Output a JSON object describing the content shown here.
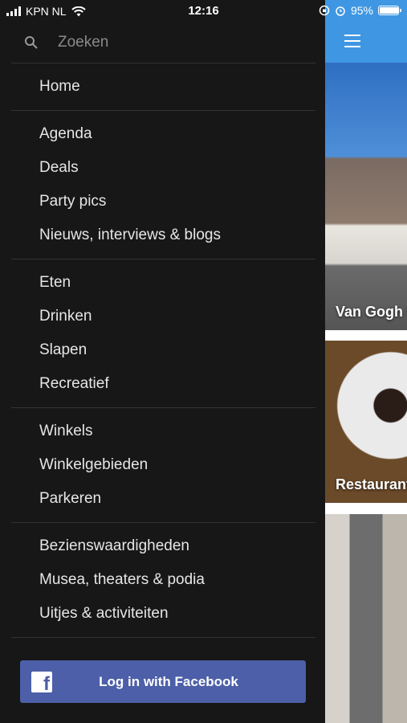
{
  "status": {
    "carrier": "KPN NL",
    "time": "12:16",
    "battery": "95%",
    "battery_level": 0.95
  },
  "search": {
    "placeholder": "Zoeken"
  },
  "menu": {
    "groups": [
      {
        "items": [
          {
            "label": "Home"
          }
        ]
      },
      {
        "items": [
          {
            "label": "Agenda"
          },
          {
            "label": "Deals"
          },
          {
            "label": "Party pics"
          },
          {
            "label": "Nieuws, interviews & blogs"
          }
        ]
      },
      {
        "items": [
          {
            "label": "Eten"
          },
          {
            "label": "Drinken"
          },
          {
            "label": "Slapen"
          },
          {
            "label": "Recreatief"
          }
        ]
      },
      {
        "items": [
          {
            "label": "Winkels"
          },
          {
            "label": "Winkelgebieden"
          },
          {
            "label": "Parkeren"
          }
        ]
      },
      {
        "items": [
          {
            "label": "Bezienswaardigheden"
          },
          {
            "label": "Musea, theaters & podia"
          },
          {
            "label": "Uitjes & activiteiten"
          }
        ]
      }
    ]
  },
  "facebook": {
    "label": "Log in with Facebook",
    "color": "#4c5fa8"
  },
  "cards": [
    {
      "title": "Van Gogh H"
    },
    {
      "title": "Restaurant"
    }
  ],
  "colors": {
    "drawer_bg": "#171717",
    "topbar": "#3f97e3"
  }
}
